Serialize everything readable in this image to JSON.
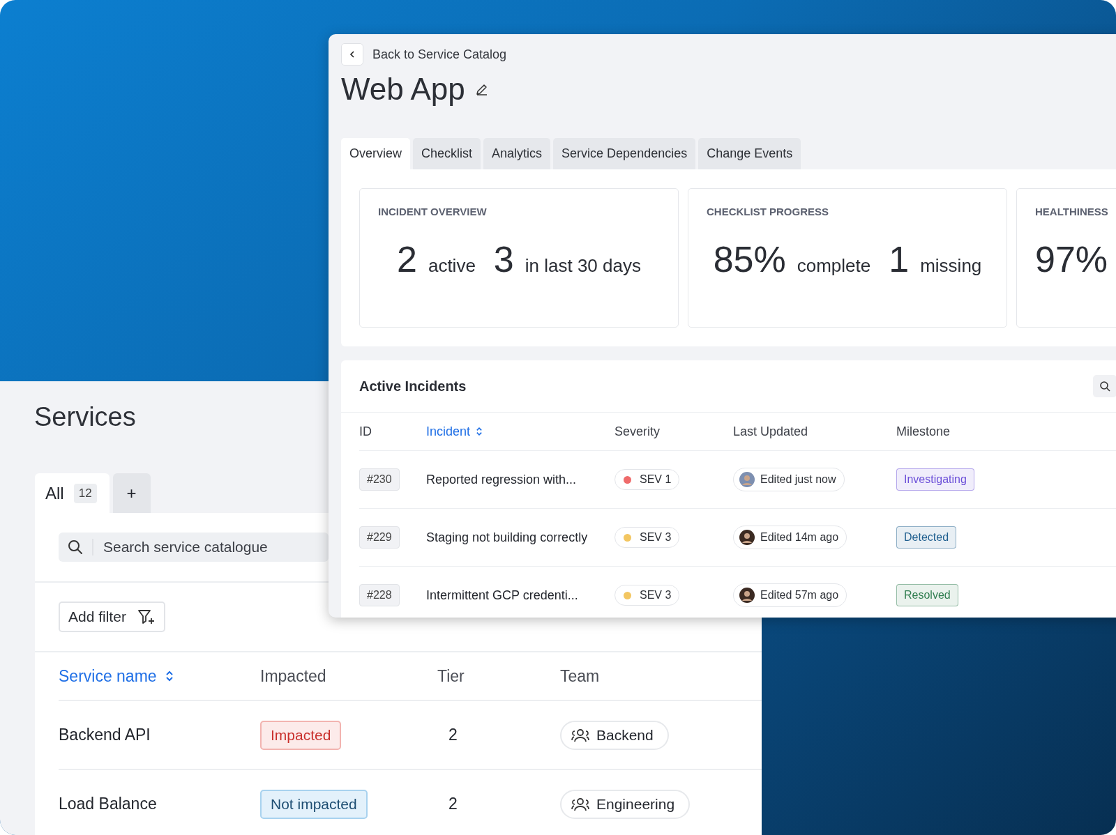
{
  "services_window": {
    "title": "Services",
    "tabs": [
      {
        "label": "All",
        "count": "12",
        "selected": true
      },
      {
        "label": "+",
        "selected": false
      }
    ],
    "search": {
      "placeholder": "Search service catalogue"
    },
    "filter_button": "Add filter",
    "table": {
      "columns": [
        {
          "label": "Service name",
          "sorted": true
        },
        {
          "label": "Impacted",
          "sorted": false
        },
        {
          "label": "Tier",
          "sorted": false
        },
        {
          "label": "Team",
          "sorted": false
        }
      ],
      "rows": [
        {
          "name": "Backend API",
          "impact": "Impacted",
          "impacted": true,
          "tier": "2",
          "team": "Backend"
        },
        {
          "name": "Load Balance",
          "impact": "Not impacted",
          "impacted": false,
          "tier": "2",
          "team": "Engineering"
        }
      ]
    }
  },
  "service_window": {
    "back_link": "Back to Service Catalog",
    "title": "Web App",
    "tabs": [
      {
        "label": "Overview",
        "selected": true
      },
      {
        "label": "Checklist",
        "selected": false
      },
      {
        "label": "Analytics",
        "selected": false
      },
      {
        "label": "Service Dependencies",
        "selected": false
      },
      {
        "label": "Change Events",
        "selected": false
      }
    ],
    "cards": [
      {
        "title": "INCIDENT OVERVIEW",
        "stats": [
          {
            "figure": "2",
            "unit": "active"
          },
          {
            "figure": "3",
            "unit": "in last 30 days"
          }
        ]
      },
      {
        "title": "CHECKLIST PROGRESS",
        "stats": [
          {
            "figure": "85%",
            "unit": "complete"
          },
          {
            "figure": "1",
            "unit": "missing"
          }
        ]
      },
      {
        "title": "HEALTHINESS",
        "stats": [
          {
            "figure": "97%"
          }
        ]
      }
    ],
    "incidents": {
      "title": "Active Incidents",
      "columns": [
        {
          "label": "ID",
          "sorted": false
        },
        {
          "label": "Incident",
          "sorted": true
        },
        {
          "label": "Severity",
          "sorted": false
        },
        {
          "label": "Last Updated",
          "sorted": false
        },
        {
          "label": "Milestone",
          "sorted": false
        }
      ],
      "rows": [
        {
          "id": "#230",
          "incident": "Reported regression with...",
          "severity": {
            "label": "SEV 1",
            "color": "#ef6b6b"
          },
          "updated": "Edited just now",
          "milestone": {
            "label": "Investigating",
            "color": "#6b4fd8"
          }
        },
        {
          "id": "#229",
          "incident": "Staging not building correctly",
          "severity": {
            "label": "SEV 3",
            "color": "#f3c661"
          },
          "updated": "Edited 14m ago",
          "milestone": {
            "label": "Detected",
            "color": "#1f5f8f"
          }
        },
        {
          "id": "#228",
          "incident": "Intermittent GCP credenti...",
          "severity": {
            "label": "SEV 3",
            "color": "#f3c661"
          },
          "updated": "Edited 57m ago",
          "milestone": {
            "label": "Resolved",
            "color": "#2f7d4f"
          }
        }
      ]
    }
  }
}
